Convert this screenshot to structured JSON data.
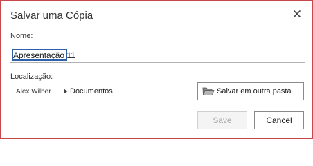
{
  "dialog": {
    "title": "Salvar uma Cópia",
    "close_icon": "close-icon",
    "accent_border_color": "#c8474b"
  },
  "name": {
    "label": "Nome:",
    "value": "Apresentação 11"
  },
  "location": {
    "label": "Localização:",
    "owner": "Alex Wilber",
    "breadcrumb": "Documentos",
    "breadcrumb_icon": "caret-right-icon",
    "save_other_label": "Salvar em outra pasta",
    "save_other_icon": "folder-open-icon"
  },
  "actions": {
    "save_label": "Save",
    "save_disabled": true,
    "cancel_label": "Cancel"
  }
}
